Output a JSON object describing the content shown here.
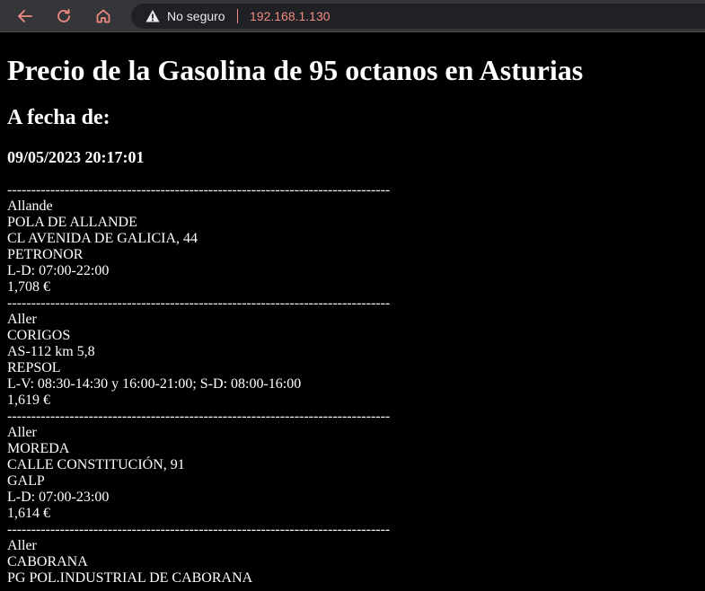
{
  "browser": {
    "security_label": "No seguro",
    "url": "192.168.1.130",
    "icons": {
      "back": "arrow-left-icon",
      "reload": "reload-icon",
      "home": "home-icon",
      "security": "warning-triangle-icon"
    },
    "colors": {
      "url_text": "#f28b82",
      "nav_icon": "#f28b82",
      "toolbar": "#35363a",
      "omnibox": "#202124"
    }
  },
  "page": {
    "title": "Precio de la Gasolina de 95 octanos en Asturias",
    "date_heading": "A fecha de:",
    "date_value": "09/05/2023 20:17:01",
    "separator": "--------------------------------------------------------------------------------",
    "stations": [
      {
        "municipality": "Allande",
        "locality": "POLA DE ALLANDE",
        "address": "CL AVENIDA DE GALICIA, 44",
        "brand": "PETRONOR",
        "hours": "L-D: 07:00-22:00",
        "price": "1,708 €"
      },
      {
        "municipality": "Aller",
        "locality": "CORIGOS",
        "address": "AS-112 km 5,8",
        "brand": "REPSOL",
        "hours": "L-V: 08:30-14:30 y 16:00-21:00; S-D: 08:00-16:00",
        "price": "1,619 €"
      },
      {
        "municipality": "Aller",
        "locality": "MOREDA",
        "address": "CALLE CONSTITUCIÓN, 91",
        "brand": "GALP",
        "hours": "L-D: 07:00-23:00",
        "price": "1,614 €"
      },
      {
        "municipality": "Aller",
        "locality": "CABORANA",
        "address": "PG POL.INDUSTRIAL DE CABORANA"
      }
    ]
  }
}
